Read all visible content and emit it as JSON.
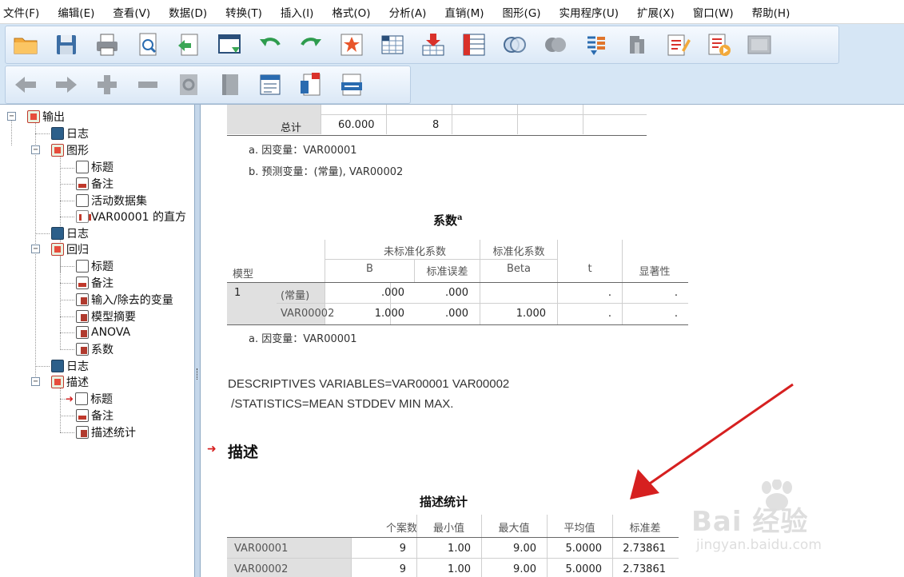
{
  "menu": [
    "文件(F)",
    "编辑(E)",
    "查看(V)",
    "数据(D)",
    "转换(T)",
    "插入(I)",
    "格式(O)",
    "分析(A)",
    "直销(M)",
    "图形(G)",
    "实用程序(U)",
    "扩展(X)",
    "窗口(W)",
    "帮助(H)"
  ],
  "toolbar1_icons": [
    "open-folder-icon",
    "save-icon",
    "print-icon",
    "print-preview-icon",
    "export-icon",
    "goto-data-icon",
    "undo-icon",
    "redo-icon",
    "goto-case-icon",
    "goto-variable-icon",
    "insert-cases-icon",
    "variables-icon",
    "select-cases-icon",
    "value-labels-icon",
    "split-file-icon",
    "designate-window-icon",
    "edit-output-icon",
    "run-script-icon",
    "disabled-icon"
  ],
  "toolbar2_icons": [
    "back-arrow-icon",
    "forward-arrow-icon",
    "expand-icon",
    "collapse-icon",
    "show-icon",
    "hide-icon",
    "insert-heading-icon",
    "insert-title-icon",
    "insert-text-icon"
  ],
  "tree": {
    "root": "输出",
    "items": [
      "日志",
      "图形",
      "标题",
      "备注",
      "活动数据集",
      "VAR00001 的直方",
      "日志",
      "回归",
      "标题",
      "备注",
      "输入/除去的变量",
      "模型摘要",
      "ANOVA",
      "系数",
      "日志",
      "描述",
      "标题",
      "备注",
      "描述统计"
    ]
  },
  "anova_tail": {
    "total_label": "总计",
    "total_ss": "60.000",
    "total_df": "8",
    "note_a": "a. 因变量：VAR00001",
    "note_b": "b. 预测变量：(常量), VAR00002"
  },
  "coef": {
    "title": "系数",
    "title_sup": "a",
    "header_group1": "未标准化系数",
    "header_group2": "标准化系数",
    "col_model": "模型",
    "col_b": "B",
    "col_se": "标准误差",
    "col_beta": "Beta",
    "col_t": "t",
    "col_sig": "显著性",
    "model_num": "1",
    "rows": [
      {
        "name": "(常量)",
        "b": ".000",
        "se": ".000",
        "beta": "",
        "t": ".",
        "sig": "."
      },
      {
        "name": "VAR00002",
        "b": "1.000",
        "se": ".000",
        "beta": "1.000",
        "t": ".",
        "sig": "."
      }
    ],
    "note": "a. 因变量：VAR00001"
  },
  "syntax": {
    "line1": "DESCRIPTIVES VARIABLES=VAR00001 VAR00002",
    "line2": " /STATISTICS=MEAN STDDEV MIN MAX."
  },
  "desc": {
    "heading": "描述",
    "title": "描述统计",
    "cols": [
      "个案数",
      "最小值",
      "最大值",
      "平均值",
      "标准差"
    ],
    "rows": [
      {
        "name": "VAR00001",
        "n": "9",
        "min": "1.00",
        "max": "9.00",
        "mean": "5.0000",
        "sd": "2.73861"
      },
      {
        "name": "VAR00002",
        "n": "9",
        "min": "1.00",
        "max": "9.00",
        "mean": "5.0000",
        "sd": "2.73861"
      }
    ]
  },
  "watermark": {
    "brand": "Bai 经验",
    "url": "jingyan.baidu.com"
  },
  "colors": {
    "toolbar_bg": "#d6e6f5",
    "arrow": "#d62020",
    "shade": "#e0e0e0"
  }
}
